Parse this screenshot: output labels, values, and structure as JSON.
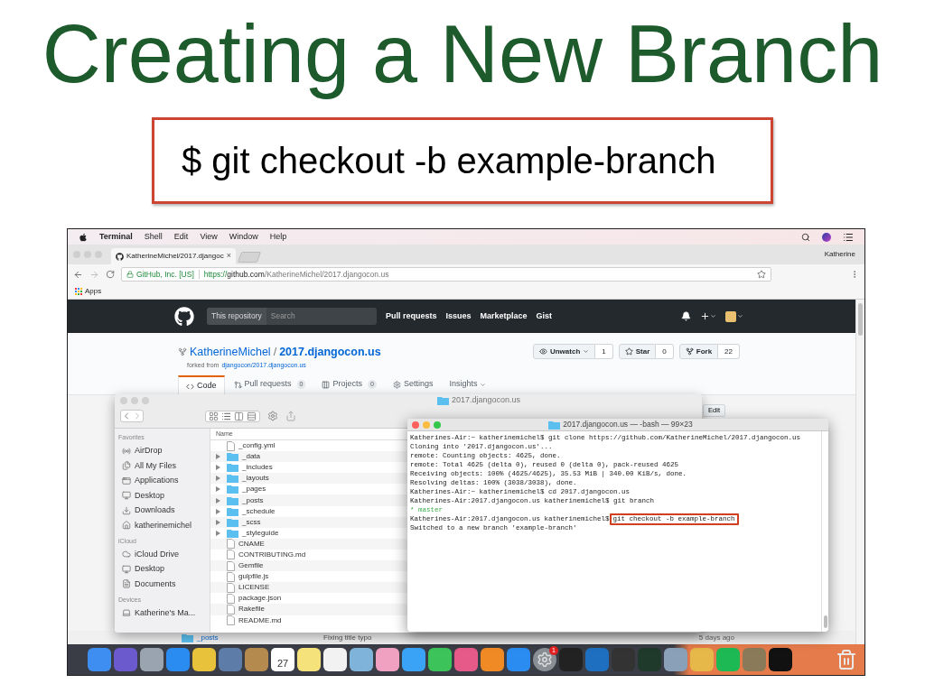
{
  "slide": {
    "title": "Creating a New Branch",
    "command": "$ git checkout -b example-branch"
  },
  "menu_bar": {
    "app": "Terminal",
    "items": [
      "Shell",
      "Edit",
      "View",
      "Window",
      "Help"
    ]
  },
  "browser": {
    "tab": {
      "title": "KatherineMichel/2017.djangoc",
      "close": "×"
    },
    "profile": "Katherine",
    "address": {
      "secure_label": "GitHub, Inc. [US]",
      "scheme": "https://",
      "host": "github.com",
      "path": "/KatherineMichel/2017.djangocon.us"
    },
    "bookmarks": [
      "Apps"
    ]
  },
  "github": {
    "scope": "This repository",
    "search_placeholder": "Search",
    "nav": [
      "Pull requests",
      "Issues",
      "Marketplace",
      "Gist"
    ],
    "owner": "KatherineMichel",
    "separator": "/",
    "repo": "2017.djangocon.us",
    "forked_from_label": "forked from",
    "forked_from": "djangocon/2017.djangocon.us",
    "actions": [
      {
        "label": "Unwatch",
        "kind": "watch",
        "count": "1"
      },
      {
        "label": "Star",
        "kind": "star",
        "count": "0"
      },
      {
        "label": "Fork",
        "kind": "fork",
        "count": "22"
      }
    ],
    "tabs": [
      {
        "label": "Code",
        "kind": "code",
        "selected": true
      },
      {
        "label": "Pull requests",
        "kind": "pulls",
        "count": "0",
        "selected": false
      },
      {
        "label": "Projects",
        "kind": "projects",
        "count": "0",
        "selected": false
      },
      {
        "label": "Settings",
        "kind": "settings",
        "selected": false
      },
      {
        "label": "Insights",
        "kind": "insights",
        "selected": false
      }
    ],
    "edit_button": "Edit",
    "file_row": {
      "name": "_posts",
      "message": "Fixing title typo",
      "age": "5 days ago"
    }
  },
  "finder": {
    "title": "2017.djangocon.us",
    "column": "Name",
    "sidebar": [
      {
        "heading": "Favorites",
        "items": [
          {
            "label": "AirDrop",
            "kind": "airdrop"
          },
          {
            "label": "All My Files",
            "kind": "files"
          },
          {
            "label": "Applications",
            "kind": "apps"
          },
          {
            "label": "Desktop",
            "kind": "desktop"
          },
          {
            "label": "Downloads",
            "kind": "downloads"
          },
          {
            "label": "katherinemichel",
            "kind": "home"
          }
        ]
      },
      {
        "heading": "iCloud",
        "items": [
          {
            "label": "iCloud Drive",
            "kind": "cloud"
          },
          {
            "label": "Desktop",
            "kind": "desktop"
          },
          {
            "label": "Documents",
            "kind": "documents"
          }
        ]
      },
      {
        "heading": "Devices",
        "items": [
          {
            "label": "Katherine's Ma...",
            "kind": "laptop"
          }
        ]
      }
    ],
    "files": [
      {
        "name": "_config.yml",
        "kind": "file"
      },
      {
        "name": "_data",
        "kind": "folder"
      },
      {
        "name": "_includes",
        "kind": "folder"
      },
      {
        "name": "_layouts",
        "kind": "folder"
      },
      {
        "name": "_pages",
        "kind": "folder"
      },
      {
        "name": "_posts",
        "kind": "folder"
      },
      {
        "name": "_schedule",
        "kind": "folder"
      },
      {
        "name": "_scss",
        "kind": "folder"
      },
      {
        "name": "_styleguide",
        "kind": "folder"
      },
      {
        "name": "CNAME",
        "kind": "file"
      },
      {
        "name": "CONTRIBUTING.md",
        "kind": "file"
      },
      {
        "name": "Gemfile",
        "kind": "file"
      },
      {
        "name": "gulpfile.js",
        "kind": "file"
      },
      {
        "name": "LICENSE",
        "kind": "file"
      },
      {
        "name": "package.json",
        "kind": "file"
      },
      {
        "name": "Rakefile",
        "kind": "file"
      },
      {
        "name": "README.md",
        "kind": "file"
      }
    ]
  },
  "terminal": {
    "title": "2017.djangocon.us — -bash — 99×23",
    "lines": [
      {
        "kind": "plain",
        "text": "Katherines-Air:~ katherinemichel$ git clone https://github.com/KatherineMichel/2017.djangocon.us"
      },
      {
        "kind": "plain",
        "text": "Cloning into '2017.djangocon.us'..."
      },
      {
        "kind": "plain",
        "text": "remote: Counting objects: 4625, done."
      },
      {
        "kind": "plain",
        "text": "remote: Total 4625 (delta 0), reused 0 (delta 0), pack-reused 4625"
      },
      {
        "kind": "plain",
        "text": "Receiving objects: 100% (4625/4625), 35.53 MiB | 340.00 KiB/s, done."
      },
      {
        "kind": "plain",
        "text": "Resolving deltas: 100% (3038/3038), done."
      },
      {
        "kind": "plain",
        "text": "Katherines-Air:~ katherinemichel$ cd 2017.djangocon.us"
      },
      {
        "kind": "plain",
        "text": "Katherines-Air:2017.djangocon.us katherinemichel$ git branch"
      },
      {
        "kind": "current-branch",
        "text": "* master"
      },
      {
        "kind": "highlighted-command",
        "prompt": "Katherines-Air:2017.djangocon.us katherinemichel$",
        "command": "git checkout -b example-branch"
      },
      {
        "kind": "plain",
        "text": "Switched to a new branch 'example-branch'"
      }
    ]
  },
  "dock": {
    "calendar_day": "27",
    "settings_badge": "1"
  }
}
